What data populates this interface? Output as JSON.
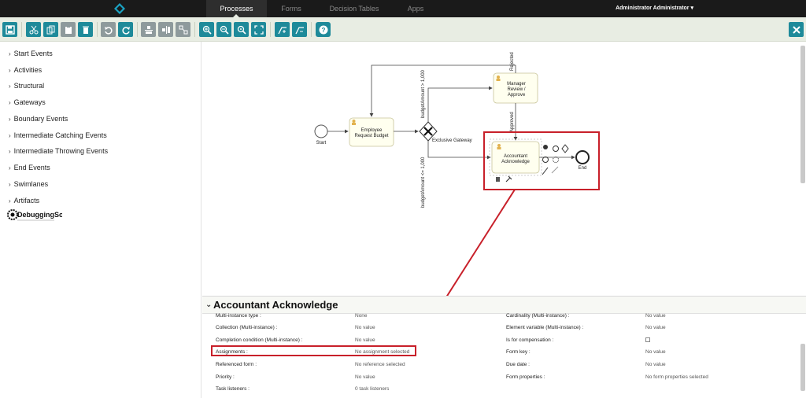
{
  "nav": {
    "tabs": [
      {
        "label": "Processes",
        "active": true
      },
      {
        "label": "Forms",
        "active": false
      },
      {
        "label": "Decision Tables",
        "active": false
      },
      {
        "label": "Apps",
        "active": false
      }
    ],
    "user": "Administrator Administrator ▾"
  },
  "toolbar": {
    "buttons": [
      "save-icon",
      "cut-icon",
      "copy-icon",
      "paste-icon",
      "delete-icon",
      "undo-icon",
      "redo-icon",
      "align-horizontal-icon",
      "align-vertical-icon",
      "same-size-icon",
      "zoom-in-icon",
      "zoom-out-icon",
      "zoom-actual-icon",
      "zoom-fit-icon",
      "bendpoint-add-icon",
      "bendpoint-remove-icon",
      "help-icon",
      "close-icon"
    ]
  },
  "sidebar": {
    "items": [
      {
        "label": "Start Events"
      },
      {
        "label": "Activities"
      },
      {
        "label": "Structural"
      },
      {
        "label": "Gateways"
      },
      {
        "label": "Boundary Events"
      },
      {
        "label": "Intermediate Catching Events"
      },
      {
        "label": "Intermediate Throwing Events"
      },
      {
        "label": "End Events"
      },
      {
        "label": "Swimlanes"
      },
      {
        "label": "Artifacts"
      }
    ],
    "brand": "DebuggingSoft"
  },
  "diagram": {
    "start_label": "Start",
    "task1": [
      "Employee",
      "Request Budget"
    ],
    "gateway_label": "Exclusive Gateway",
    "task2": [
      "Manager",
      "Review /",
      "Approve"
    ],
    "task3": [
      "Accountant",
      "Acknowledge"
    ],
    "end_label": "End",
    "flow_gt": "budgetAmount > 1,000",
    "flow_le": "budgetAmount <= 1,000",
    "flow_rejected": "Rejected",
    "flow_approved": "Approved",
    "accent": "#c8202a",
    "task_fill": "#ffffef",
    "task_stroke": "#c8c49a"
  },
  "properties": {
    "title": "Accountant Acknowledge",
    "left_rows": [
      {
        "label": "Multi-instance type :",
        "value": "None"
      },
      {
        "label": "Collection (Multi-instance) :",
        "value": "No value"
      },
      {
        "label": "Completion condition (Multi-instance) :",
        "value": "No value"
      },
      {
        "label": "Assignments :",
        "value": "No assignment selected"
      },
      {
        "label": "Referenced form :",
        "value": "No reference selected"
      },
      {
        "label": "Priority :",
        "value": "No value"
      },
      {
        "label": "Task listeners :",
        "value": "0 task listeners"
      }
    ],
    "right_rows": [
      {
        "label": "Cardinality (Multi-instance) :",
        "value": "No value"
      },
      {
        "label": "Element variable (Multi-instance) :",
        "value": "No value"
      },
      {
        "label": "Is for compensation :",
        "value": ""
      },
      {
        "label": "Form key :",
        "value": "No value"
      },
      {
        "label": "Due date :",
        "value": "No value"
      },
      {
        "label": "Form properties :",
        "value": "No form properties selected"
      }
    ]
  }
}
